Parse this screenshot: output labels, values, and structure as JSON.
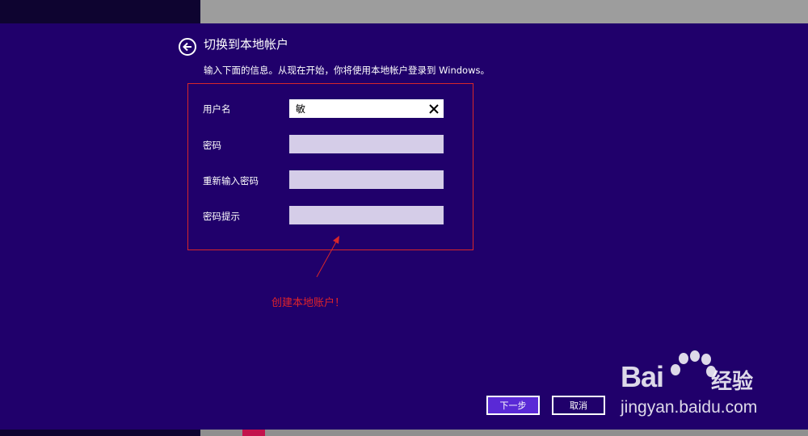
{
  "header": {
    "title": "切换到本地帐户",
    "subtitle": "输入下面的信息。从现在开始，你将使用本地帐户登录到 Windows。"
  },
  "form": {
    "username": {
      "label": "用户名",
      "value": "敏"
    },
    "password": {
      "label": "密码",
      "value": ""
    },
    "confirm_password": {
      "label": "重新输入密码",
      "value": ""
    },
    "password_hint": {
      "label": "密码提示",
      "value": ""
    }
  },
  "annotation": {
    "text": "创建本地账户！",
    "color": "#e0232a"
  },
  "buttons": {
    "next": "下一步",
    "cancel": "取消"
  },
  "watermark": {
    "brand": "Bai",
    "brand_suffix": "经验",
    "url": "jingyan.baidu.com"
  },
  "colors": {
    "background": "#20006b",
    "accent": "#5a29d6",
    "highlight": "#d8262a"
  }
}
